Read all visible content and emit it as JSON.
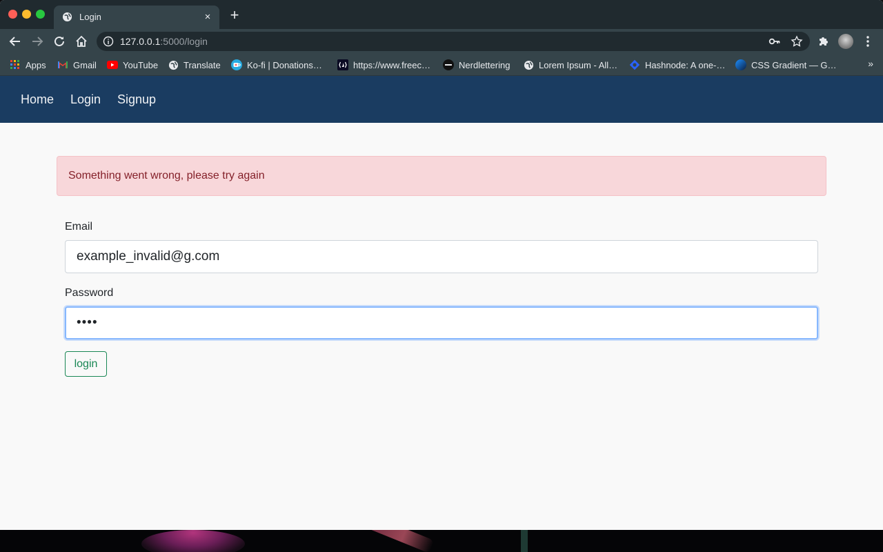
{
  "browser": {
    "tab_title": "Login",
    "tab_close": "×",
    "new_tab": "+",
    "url_host": "127.0.0.1",
    "url_rest": ":5000/login",
    "bookmarks": [
      {
        "label": "Apps",
        "icon": "apps-grid-icon"
      },
      {
        "label": "Gmail",
        "icon": "gmail-icon"
      },
      {
        "label": "YouTube",
        "icon": "youtube-icon"
      },
      {
        "label": "Translate",
        "icon": "globe-icon"
      },
      {
        "label": "Ko-fi | Donations…",
        "icon": "kofi-icon"
      },
      {
        "label": "https://www.freec…",
        "icon": "freecodecamp-icon"
      },
      {
        "label": "Nerdlettering",
        "icon": "nerdlettering-icon"
      },
      {
        "label": "Lorem Ipsum - All…",
        "icon": "globe-icon"
      },
      {
        "label": "Hashnode: A one-…",
        "icon": "hashnode-icon"
      },
      {
        "label": "CSS Gradient — G…",
        "icon": "css-gradient-icon"
      }
    ],
    "bookmarks_more": "»"
  },
  "navbar": {
    "links": [
      "Home",
      "Login",
      "Signup"
    ]
  },
  "alert": {
    "message": "Something went wrong, please try again"
  },
  "form": {
    "email_label": "Email",
    "email_value": "example_invalid@g.com",
    "password_label": "Password",
    "password_value": "••••",
    "submit_label": "login"
  },
  "colors": {
    "navbar_bg": "#1a3c61",
    "alert_bg": "#f8d7da",
    "alert_text": "#842029",
    "button_outline": "#198754",
    "focus_ring": "#86b7fe"
  }
}
